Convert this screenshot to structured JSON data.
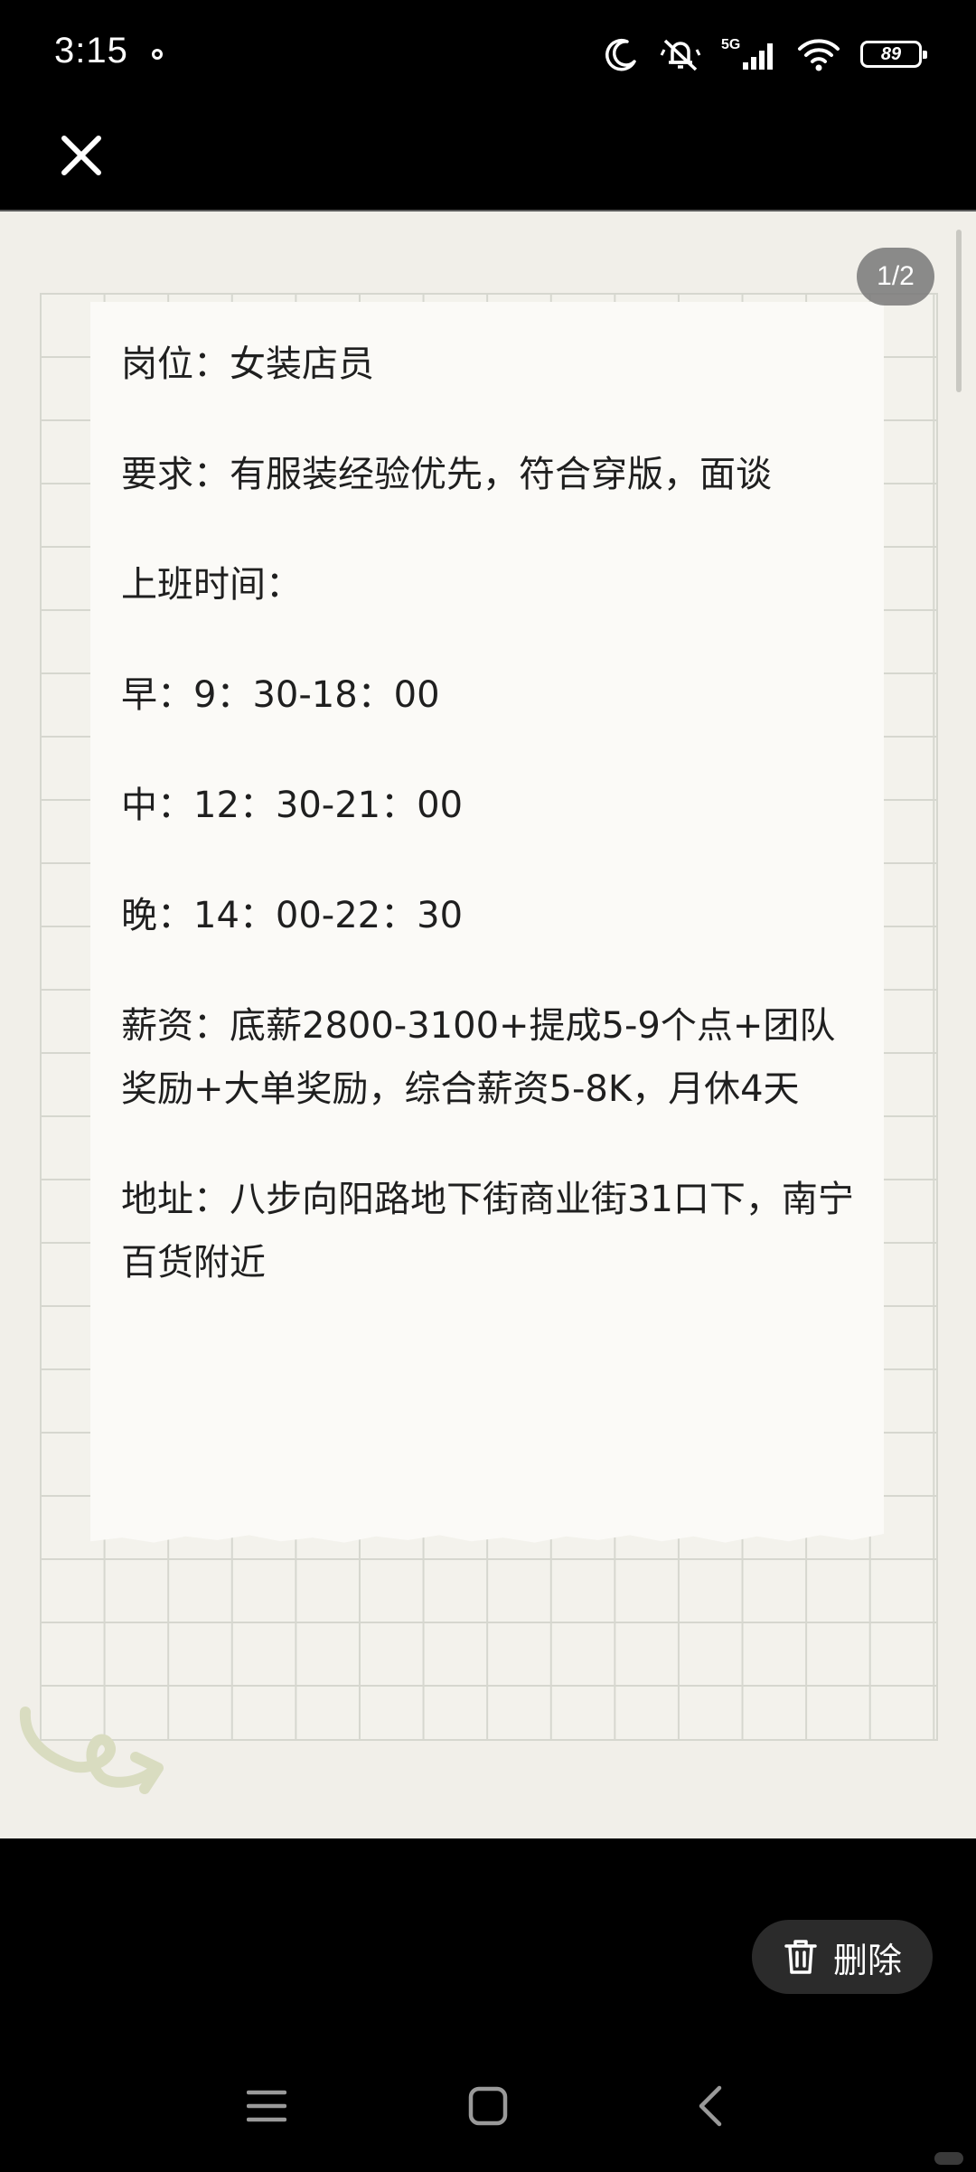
{
  "status_bar": {
    "time": "3:15",
    "network": "5G",
    "battery": "89"
  },
  "viewer": {
    "page_indicator": "1/2",
    "note_lines": [
      "岗位：女装店员",
      "要求：有服装经验优先，符合穿版，面谈",
      "上班时间：",
      "早：9：30-18：00",
      "中：12：30-21：00",
      "晚：14：00-22：30",
      "薪资：底薪2800-3100+提成5-9个点+团队奖励+大单奖励，综合薪资5-8K，月休4天",
      "地址：八步向阳路地下街商业街31口下，南宁百货附近"
    ]
  },
  "actions": {
    "delete_label": "删除"
  },
  "icons": {
    "close": "close-icon",
    "delete": "trash-icon",
    "menu": "menu-icon",
    "home": "home-icon",
    "back": "back-icon"
  }
}
